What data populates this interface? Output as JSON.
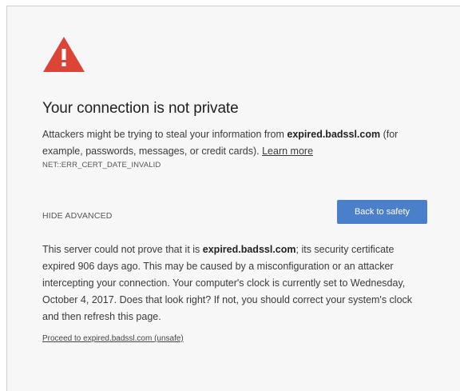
{
  "icon": {
    "name": "warning-triangle-icon",
    "color": "#db4437"
  },
  "heading": {
    "title": "Your connection is not private"
  },
  "main": {
    "text_before": "Attackers might be trying to steal your information from ",
    "domain": "expired.badssl.com",
    "text_after": " (for example, passwords, messages, or credit cards). ",
    "learn_more": "Learn more"
  },
  "error_code": "NET::ERR_CERT_DATE_INVALID",
  "controls": {
    "hide_advanced": "HIDE ADVANCED",
    "back_to_safety": "Back to safety",
    "button_color": "#4a7fc9"
  },
  "details": {
    "text_before": "This server could not prove that it is ",
    "domain": "expired.badssl.com",
    "text_after": "; its security certificate expired 906 days ago. This may be caused by a misconfiguration or an attacker intercepting your connection. Your computer's clock is currently set to Wednesday, October 4, 2017. Does that look right? If not, you should correct your system's clock and then refresh this page."
  },
  "proceed_link": "Proceed to expired.badssl.com (unsafe)"
}
